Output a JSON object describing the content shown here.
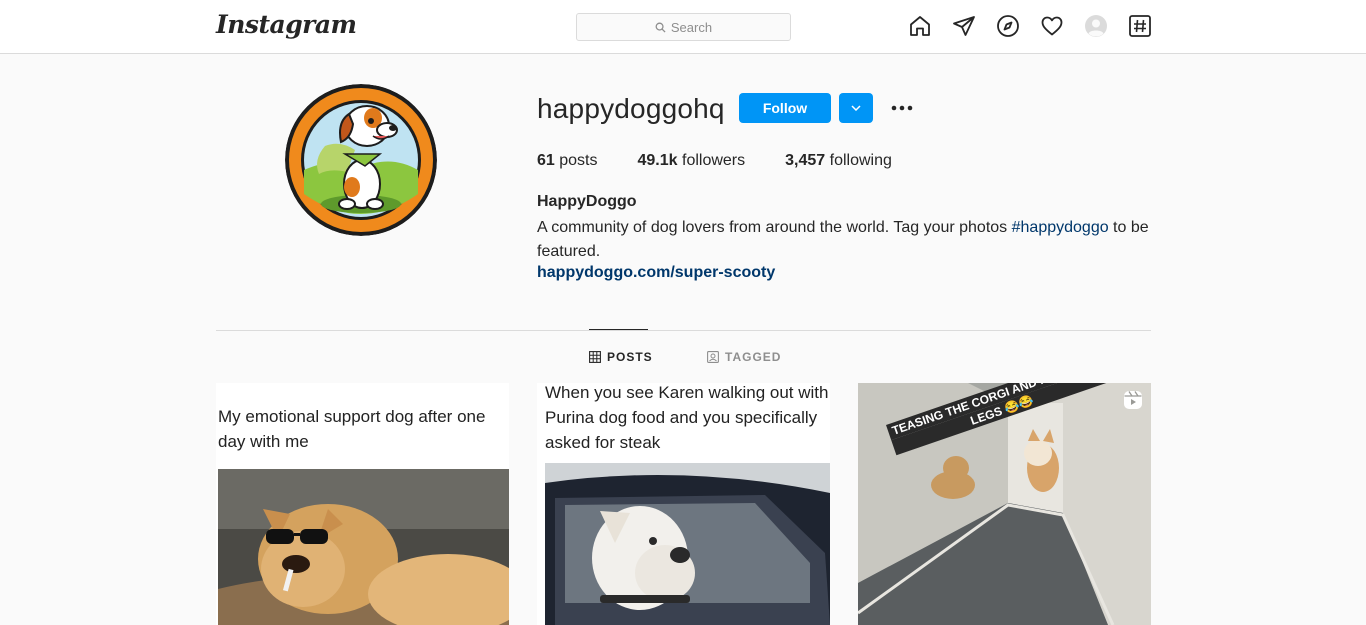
{
  "nav": {
    "logo": "Instagram",
    "search_placeholder": "Search",
    "icons": [
      "home-icon",
      "direct-icon",
      "explore-icon",
      "activity-icon",
      "profile-avatar-icon",
      "hashtag-icon"
    ]
  },
  "profile": {
    "username": "happydoggohq",
    "follow_label": "Follow",
    "stats": {
      "posts_count": "61",
      "posts_label": "posts",
      "followers_count": "49.1k",
      "followers_label": "followers",
      "following_count": "3,457",
      "following_label": "following"
    },
    "full_name": "HappyDoggo",
    "bio_before": "A community of dog lovers from around the world. Tag your photos ",
    "bio_hashtag": "#happydoggo",
    "bio_after": " to be featured.",
    "website": "happydoggo.com/super-scooty"
  },
  "tabs": {
    "posts_label": "POSTS",
    "tagged_label": "TAGGED"
  },
  "posts": [
    {
      "caption": "My emotional support dog after one day with me"
    },
    {
      "caption": "When you see Karen walking out with Purina dog food and you specifically asked for steak"
    },
    {
      "banner_line1": "TEASING THE CORGI AND HIS SHORT",
      "banner_line2": "LEGS 😂😂"
    }
  ],
  "colors": {
    "accent": "#0095f6",
    "link": "#00376b",
    "avatar_ring": "#f08a1c"
  }
}
